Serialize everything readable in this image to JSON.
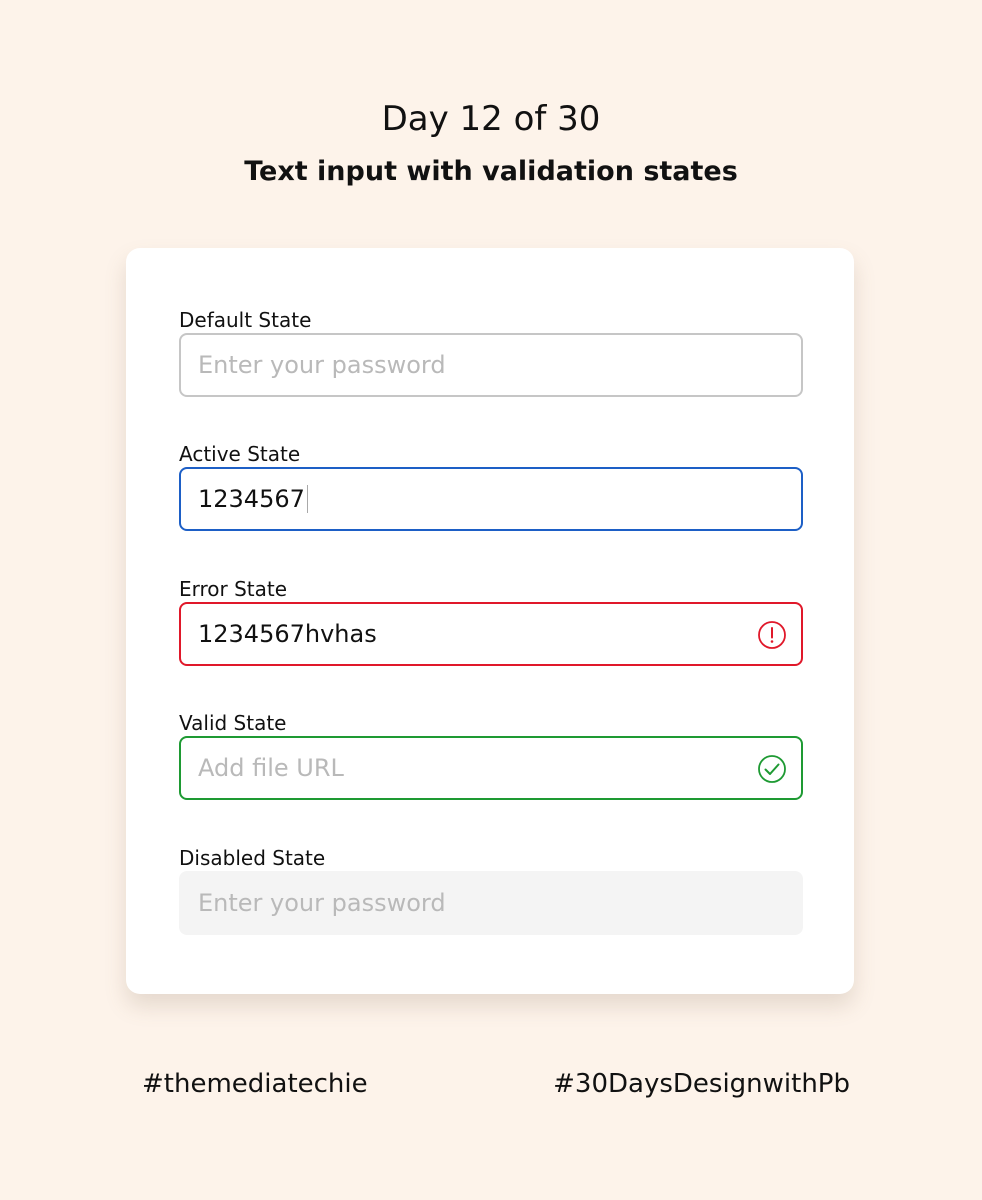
{
  "header": {
    "day_label": "Day 12 of 30",
    "subtitle": "Text input with validation states"
  },
  "fields": [
    {
      "label": "Default State",
      "state": "default",
      "value": "",
      "placeholder": "Enter your password",
      "border_color": "#C6C6C6"
    },
    {
      "label": "Active State",
      "state": "active",
      "value": "1234567",
      "placeholder": "",
      "border_color": "#1D5FC6"
    },
    {
      "label": "Error State",
      "state": "error",
      "value": "1234567hvhas",
      "placeholder": "",
      "border_color": "#E0182A",
      "icon": "error-alert-icon"
    },
    {
      "label": "Valid State",
      "state": "valid",
      "value": "",
      "placeholder": "Add file URL",
      "border_color": "#1E9A33",
      "icon": "check-circle-icon"
    },
    {
      "label": "Disabled State",
      "state": "disabled",
      "value": "",
      "placeholder": "Enter your password",
      "background": "#F4F4F4"
    }
  ],
  "footer": {
    "left_tag": "#themediatechie",
    "right_tag": "#30DaysDesignwithPb"
  },
  "colors": {
    "page_background": "#FDF3EA",
    "card_background": "#FFFFFF",
    "active": "#1D5FC6",
    "error": "#E0182A",
    "valid": "#1E9A33",
    "placeholder_text": "#B9B9B9"
  }
}
